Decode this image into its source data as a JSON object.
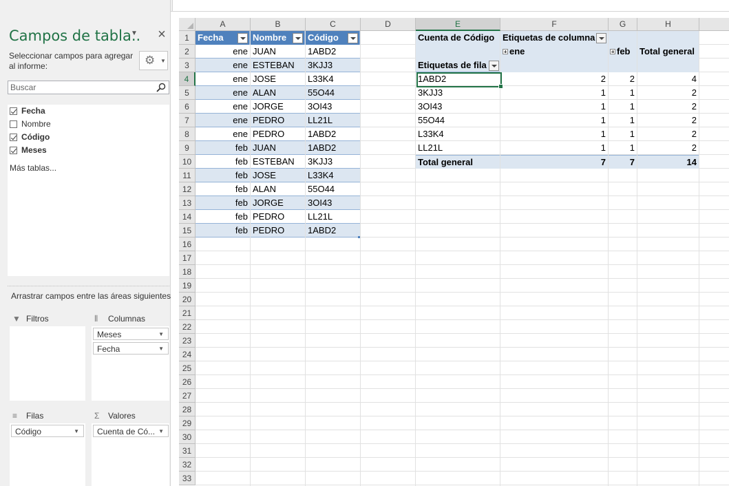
{
  "pane": {
    "title": "Campos de tabla..",
    "subtitle": "Seleccionar campos para agregar al informe:",
    "search_placeholder": "Buscar",
    "fields": [
      {
        "label": "Fecha",
        "checked": true
      },
      {
        "label": "Nombre",
        "checked": false
      },
      {
        "label": "Código",
        "checked": true
      },
      {
        "label": "Meses",
        "checked": true
      }
    ],
    "more_tables": "Más tablas...",
    "drag_hint": "Arrastrar campos entre las áreas siguientes:",
    "areas": {
      "filters_label": "Filtros",
      "columns_label": "Columnas",
      "rows_label": "Filas",
      "values_label": "Valores",
      "columns_fields": [
        "Meses",
        "Fecha"
      ],
      "rows_fields": [
        "Código"
      ],
      "values_fields": [
        "Cuenta de Có..."
      ]
    }
  },
  "grid": {
    "columns": [
      "A",
      "B",
      "C",
      "D",
      "E",
      "F",
      "G",
      "H"
    ],
    "selected_column": "E",
    "row_numbers": [
      "1",
      "2",
      "3",
      "4",
      "5",
      "6",
      "7",
      "8",
      "9",
      "10",
      "11",
      "12",
      "13",
      "14",
      "15",
      "16",
      "17",
      "18",
      "19",
      "20",
      "21",
      "22",
      "23",
      "24",
      "25",
      "26",
      "27",
      "28",
      "29",
      "30",
      "31",
      "32",
      "33"
    ],
    "selected_row": "4"
  },
  "table": {
    "headers": [
      "Fecha",
      "Nombre",
      "Código"
    ],
    "rows": [
      [
        "ene",
        "JUAN",
        "1ABD2"
      ],
      [
        "ene",
        "ESTEBAN",
        "3KJJ3"
      ],
      [
        "ene",
        "JOSE",
        "L33K4"
      ],
      [
        "ene",
        "ALAN",
        "55O44"
      ],
      [
        "ene",
        "JORGE",
        "3OI43"
      ],
      [
        "ene",
        "PEDRO",
        "LL21L"
      ],
      [
        "ene",
        "PEDRO",
        "1ABD2"
      ],
      [
        "feb",
        "JUAN",
        "1ABD2"
      ],
      [
        "feb",
        "ESTEBAN",
        "3KJJ3"
      ],
      [
        "feb",
        "JOSE",
        "L33K4"
      ],
      [
        "feb",
        "ALAN",
        "55O44"
      ],
      [
        "feb",
        "JORGE",
        "3OI43"
      ],
      [
        "feb",
        "PEDRO",
        "LL21L"
      ],
      [
        "feb",
        "PEDRO",
        "1ABD2"
      ]
    ]
  },
  "pivot": {
    "value_label": "Cuenta de Código",
    "column_labels": "Etiquetas de columna",
    "row_labels": "Etiquetas de fila",
    "col_ene": "ene",
    "col_feb": "feb",
    "col_total": "Total general",
    "rows": [
      {
        "label": "1ABD2",
        "ene": "2",
        "feb": "2",
        "total": "4"
      },
      {
        "label": "3KJJ3",
        "ene": "1",
        "feb": "1",
        "total": "2"
      },
      {
        "label": "3OI43",
        "ene": "1",
        "feb": "1",
        "total": "2"
      },
      {
        "label": "55O44",
        "ene": "1",
        "feb": "1",
        "total": "2"
      },
      {
        "label": "L33K4",
        "ene": "1",
        "feb": "1",
        "total": "2"
      },
      {
        "label": "LL21L",
        "ene": "1",
        "feb": "1",
        "total": "2"
      }
    ],
    "grand": {
      "label": "Total general",
      "ene": "7",
      "feb": "7",
      "total": "14"
    }
  }
}
